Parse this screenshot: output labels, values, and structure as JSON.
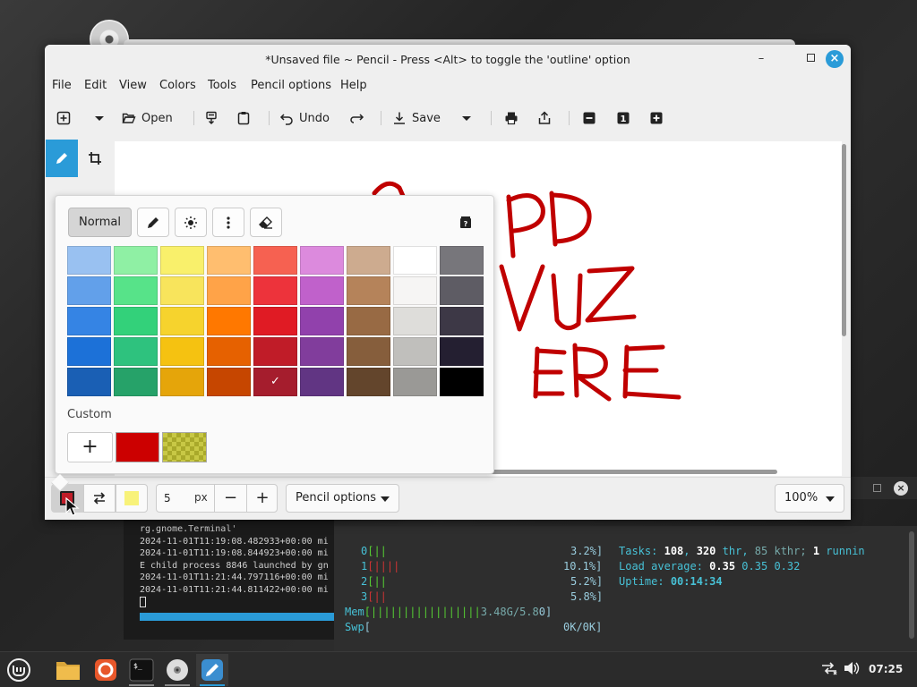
{
  "window": {
    "title": "*Unsaved file ~ Pencil - Press <Alt> to toggle the 'outline' option",
    "minimize": "–",
    "close": "×"
  },
  "menu": [
    "File",
    "Edit",
    "View",
    "Colors",
    "Tools",
    "Pencil options",
    "Help"
  ],
  "toolbar": {
    "open": "Open",
    "undo": "Undo",
    "save": "Save"
  },
  "canvas_text": [
    "PD",
    "VUZ",
    "ERE"
  ],
  "canvas_color": "#c00000",
  "popover": {
    "mode_normal": "Normal",
    "custom_label": "Custom",
    "custom_add": "+",
    "palette": [
      [
        "#99c1f1",
        "#8ff0a4",
        "#f9f06b",
        "#ffbe6f",
        "#f66151",
        "#dc8add",
        "#cdab8f",
        "#ffffff",
        "#77767b"
      ],
      [
        "#62a0ea",
        "#57e389",
        "#f8e45c",
        "#ffa348",
        "#ed333b",
        "#c061cb",
        "#b5835a",
        "#f6f5f4",
        "#5e5c64"
      ],
      [
        "#3584e4",
        "#33d17a",
        "#f6d32d",
        "#ff7800",
        "#e01b24",
        "#9141ac",
        "#986a44",
        "#deddda",
        "#3d3846"
      ],
      [
        "#1c71d8",
        "#2ec27e",
        "#f5c211",
        "#e66100",
        "#c01c28",
        "#813d9c",
        "#865e3c",
        "#c0bfbc",
        "#241f31"
      ],
      [
        "#1a5fb4",
        "#26a269",
        "#e5a50a",
        "#c64600",
        "#a51d2d",
        "#613583",
        "#63452c",
        "#9a9996",
        "#000000"
      ]
    ],
    "selected": "✓",
    "custom_color": "#cc0000"
  },
  "bottombar": {
    "primary_color": "#c01c28",
    "secondary_color": "#f8f27a",
    "size_value": "5",
    "size_unit": "px",
    "minus": "−",
    "plus": "+",
    "options_label": "Pencil options",
    "zoom_label": "100%"
  },
  "terminal": {
    "lines": [
      "rg.gnome.Terminal'",
      "2024-11-01T11:19:08.482933+00:00 mi",
      "2024-11-01T11:19:08.844923+00:00 mi",
      "E child process 8846 launched by gn",
      "2024-11-01T11:21:44.797116+00:00 mi",
      "2024-11-01T11:21:44.811422+00:00 mi"
    ]
  },
  "htop": {
    "cpu": [
      {
        "id": "0",
        "bar": "[||",
        "pct": "3.2%]"
      },
      {
        "id": "1",
        "bar": "[||||",
        "pct": "10.1%]"
      },
      {
        "id": "2",
        "bar": "[||",
        "pct": "5.2%]"
      },
      {
        "id": "3",
        "bar": "[||",
        "pct": "5.8%]"
      }
    ],
    "mem_label": "Mem",
    "mem_bar": "[|||||||||||||||||",
    "mem_value": "3.48G/5.8",
    "mem_end": "0]",
    "swp_label": "Swp",
    "swp_bar": "[",
    "swp_value": "0K/0K]",
    "tasks_label": "Tasks:",
    "tasks_value": "108",
    "thr_value": "320",
    "thr_label": "thr,",
    "kthr_value": "85 kthr;",
    "running_value": "1",
    "running_label": "runnin",
    "load_label": "Load average:",
    "load1": "0.35",
    "load5": "0.35",
    "load15": "0.32",
    "uptime_label": "Uptime:",
    "uptime_value": "00:14:34"
  },
  "taskbar": {
    "clock": "07:25"
  }
}
